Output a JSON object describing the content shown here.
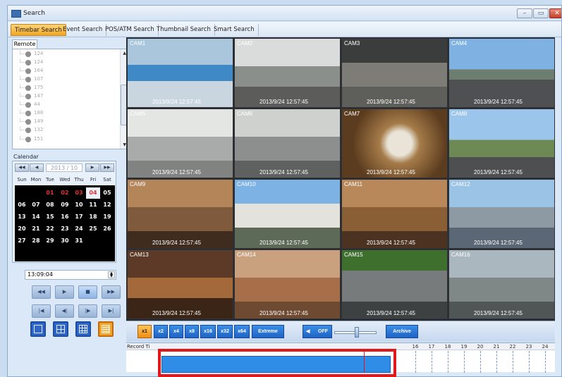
{
  "window": {
    "title": "Search"
  },
  "tabs": [
    "Timebar Search",
    "Event Search",
    "POS/ATM Search",
    "Thumbnail Search",
    "Smart Search"
  ],
  "remote": {
    "tab_label": "Remote",
    "items": [
      "124",
      "124",
      "164",
      "107",
      "175",
      "147",
      "44",
      "188",
      "149",
      "132",
      "151"
    ]
  },
  "calendar": {
    "label": "Calendar",
    "month": "2013 / 10",
    "headers": [
      "Sun",
      "Mon",
      "Tue",
      "Wed",
      "Thu",
      "Fri",
      "Sat"
    ],
    "selected_day": "04",
    "rows": [
      [
        "",
        "",
        "01",
        "02",
        "03",
        "04",
        "05"
      ],
      [
        "06",
        "07",
        "08",
        "09",
        "10",
        "11",
        "12"
      ],
      [
        "13",
        "14",
        "15",
        "16",
        "17",
        "18",
        "19"
      ],
      [
        "20",
        "21",
        "22",
        "23",
        "24",
        "25",
        "26"
      ],
      [
        "27",
        "28",
        "29",
        "30",
        "31",
        "",
        ""
      ]
    ],
    "red_days": [
      "01",
      "02",
      "03",
      "04"
    ]
  },
  "time_field": {
    "value": "13:09:04"
  },
  "cameras": [
    {
      "label": "CAM1",
      "timestamp": "2013/9/24 12:57:45"
    },
    {
      "label": "CAM2",
      "timestamp": "2013/9/24 12:57:45"
    },
    {
      "label": "CAM3",
      "timestamp": "2013/9/24 12:57:45"
    },
    {
      "label": "CAM4",
      "timestamp": "2013/9/24 12:57:45"
    },
    {
      "label": "CAM5",
      "timestamp": "2013/9/24 12:57:45"
    },
    {
      "label": "CAM6",
      "timestamp": "2013/9/24 12:57:45"
    },
    {
      "label": "CAM7",
      "timestamp": "2013/9/24 12:57:45"
    },
    {
      "label": "CAM8",
      "timestamp": "2013/9/24 12:57:45"
    },
    {
      "label": "CAM9",
      "timestamp": "2013/9/24 12:57:45"
    },
    {
      "label": "CAM10",
      "timestamp": "2013/9/24 12:57:45"
    },
    {
      "label": "CAM11",
      "timestamp": "2013/9/24 12:57:45"
    },
    {
      "label": "CAM12",
      "timestamp": "2013/9/24 12:57:45"
    },
    {
      "label": "CAM13",
      "timestamp": "2013/9/24 12:57:45"
    },
    {
      "label": "CAM14",
      "timestamp": "2013/9/24 12:57:45"
    },
    {
      "label": "CAM15",
      "timestamp": "2013/9/24 12:57:45"
    },
    {
      "label": "CAM16",
      "timestamp": "2013/9/24 12:57:45"
    }
  ],
  "speeds": [
    "x1",
    "x2",
    "x4",
    "x8",
    "x16",
    "x32",
    "x64",
    "Extreme"
  ],
  "audio": {
    "label": "OFF"
  },
  "archive": {
    "label": "Archive"
  },
  "timeline": {
    "label": "Record Ti",
    "hours": [
      "16",
      "17",
      "18",
      "19",
      "20",
      "21",
      "22",
      "23",
      "24"
    ]
  }
}
